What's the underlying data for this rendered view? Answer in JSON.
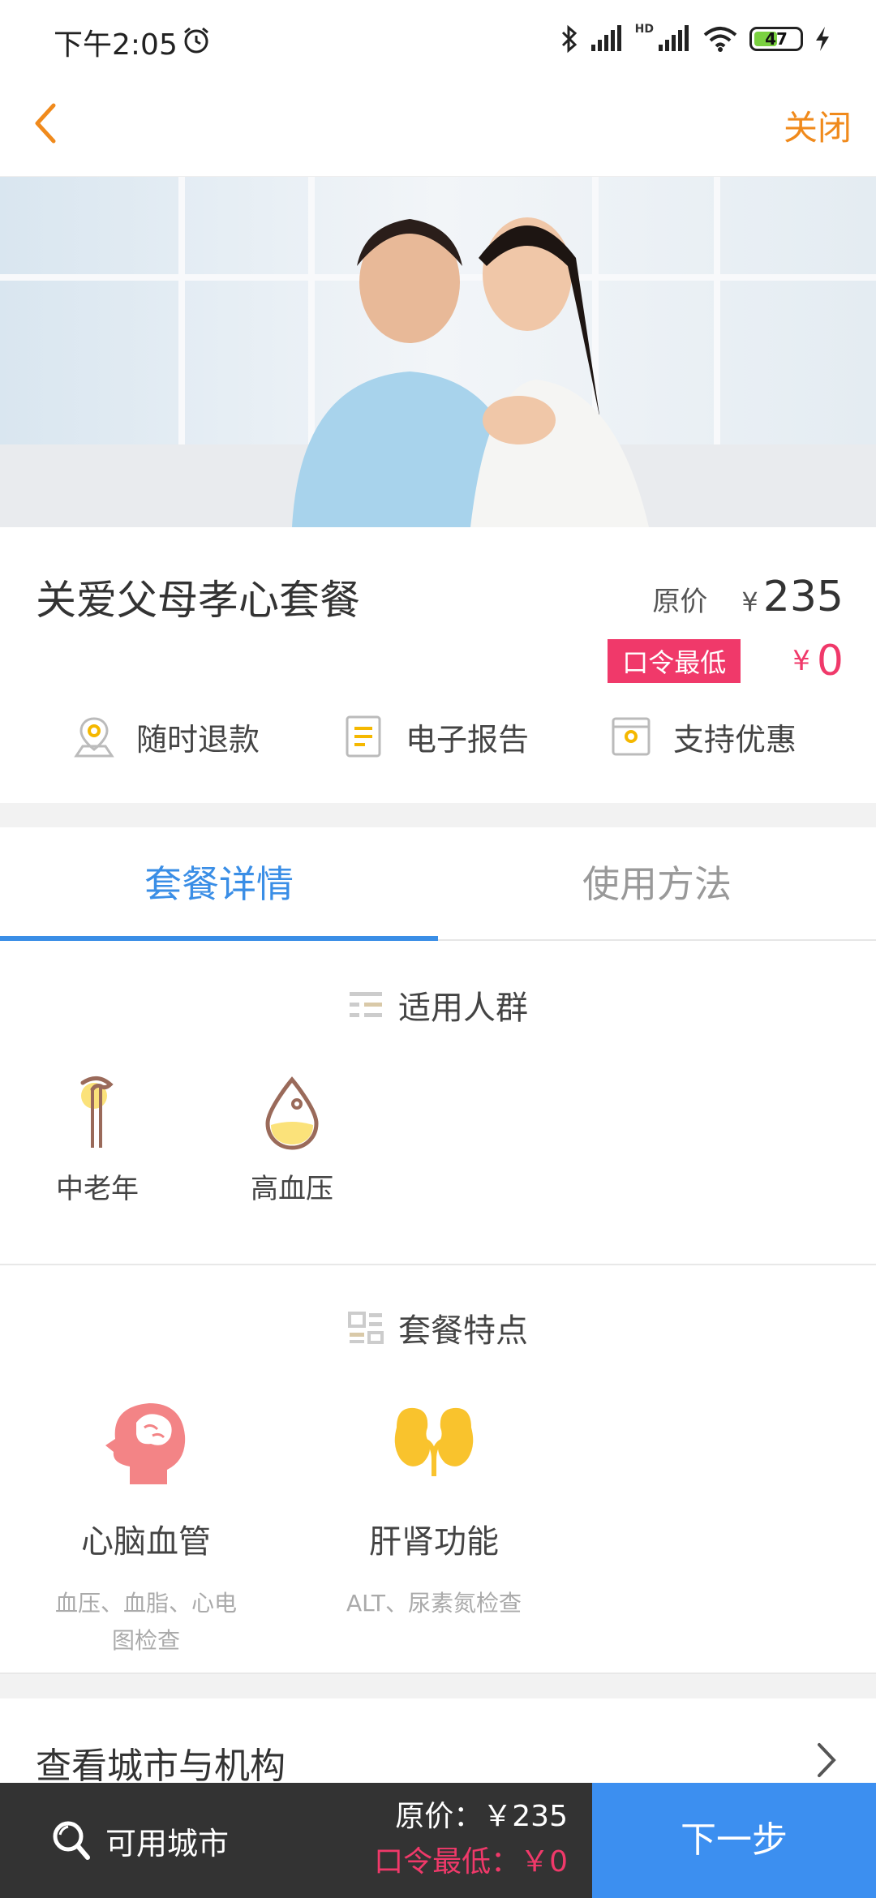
{
  "status_bar": {
    "time": "下午2:05",
    "battery": "47",
    "network_badge": "HD"
  },
  "nav": {
    "close_label": "关闭"
  },
  "package": {
    "title": "关爱父母孝心套餐",
    "original_label": "原价",
    "currency": "¥",
    "original_price": "235",
    "promo_badge": "口令最低",
    "promo_price": "0"
  },
  "features": [
    {
      "label": "随时退款",
      "icon": "location-refund-icon"
    },
    {
      "label": "电子报告",
      "icon": "report-document-icon"
    },
    {
      "label": "支持优惠",
      "icon": "coupon-icon"
    }
  ],
  "tabs": [
    {
      "label": "套餐详情",
      "active": true
    },
    {
      "label": "使用方法",
      "active": false
    }
  ],
  "crowd_section": {
    "title": "适用人群",
    "items": [
      {
        "label": "中老年",
        "icon": "cane-icon"
      },
      {
        "label": "高血压",
        "icon": "blood-drop-icon"
      }
    ]
  },
  "traits_section": {
    "title": "套餐特点",
    "items": [
      {
        "title": "心脑血管",
        "desc": "血压、血脂、心电图检查",
        "icon": "head-brain-icon"
      },
      {
        "title": "肝肾功能",
        "desc": "ALT、尿素氮检查",
        "icon": "kidney-icon"
      }
    ]
  },
  "city_row": {
    "label": "查看城市与机构"
  },
  "bottom_bar": {
    "city_label": "可用城市",
    "original_text": "原价：￥235",
    "promo_text": "口令最低：￥0",
    "next_label": "下一步"
  },
  "colors": {
    "accent": "#3a8ee6",
    "orange": "#f08a1c",
    "promo": "#f0396a",
    "dark_bar": "#333333",
    "next_button": "#3c8ff0"
  }
}
